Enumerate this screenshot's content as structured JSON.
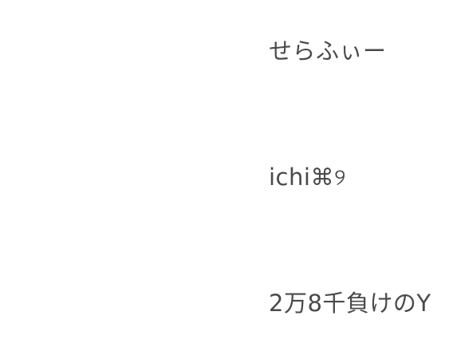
{
  "items": [
    {
      "name": "せらふぃー"
    },
    {
      "name": "ichi⌘୨"
    },
    {
      "name": "2万8千負けのY"
    }
  ]
}
